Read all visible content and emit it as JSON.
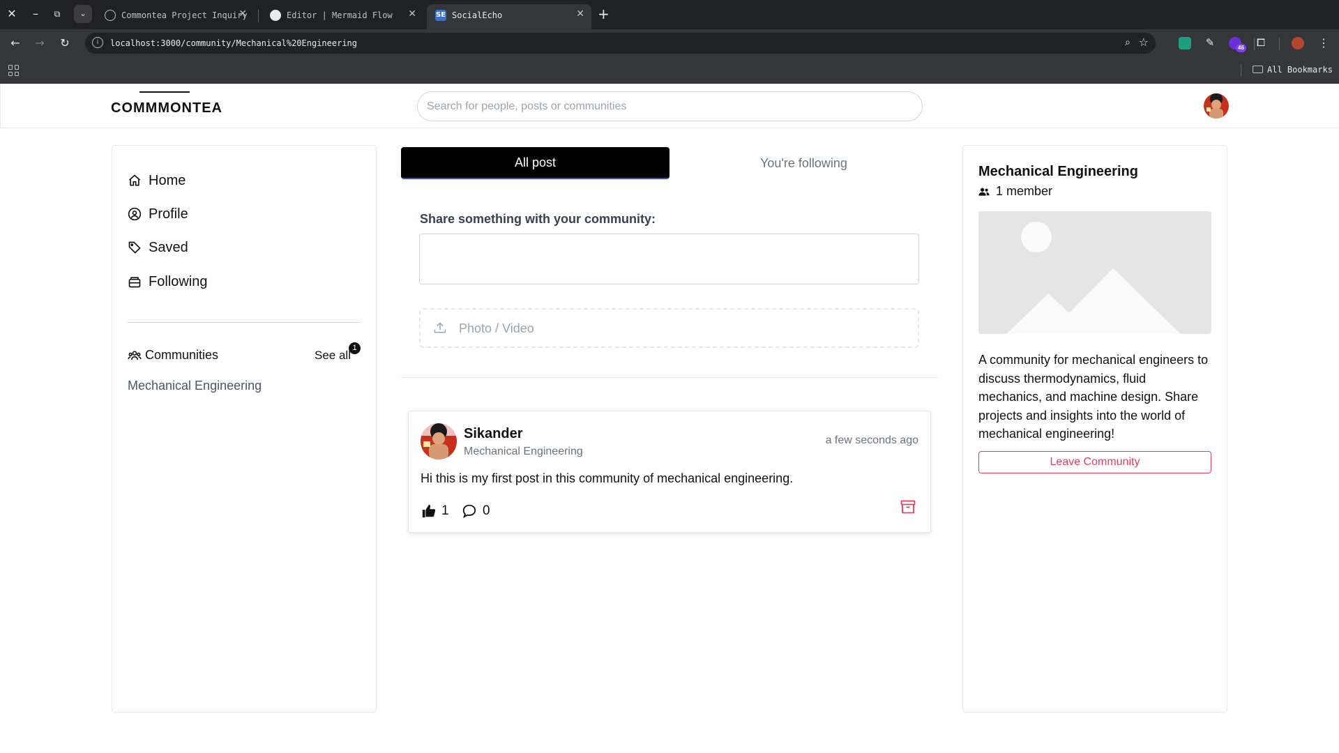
{
  "browser": {
    "tabs": [
      {
        "title": "Commontea Project Inquiry",
        "favicon": "globe-icon",
        "active": false
      },
      {
        "title": "Editor | Mermaid Flow",
        "favicon": "mermaid-icon",
        "active": false
      },
      {
        "title": "SocialEcho",
        "favicon": "socialecho-icon",
        "active": true
      }
    ],
    "url": "localhost:3000/community/Mechanical%20Engineering",
    "extension_badge": "46",
    "bookmarks_label": "All Bookmarks"
  },
  "app": {
    "logo": "COMMMONTEA",
    "search_placeholder": "Search for people, posts or communities"
  },
  "sidebar": {
    "items": [
      {
        "label": "Home",
        "icon": "home-icon"
      },
      {
        "label": "Profile",
        "icon": "user-circle-icon"
      },
      {
        "label": "Saved",
        "icon": "tag-icon"
      },
      {
        "label": "Following",
        "icon": "inbox-icon"
      }
    ],
    "communities_label": "Communities",
    "see_all_label": "See all",
    "see_all_badge": "1",
    "communities": [
      "Mechanical Engineering"
    ]
  },
  "feed": {
    "tabs": [
      {
        "label": "All post",
        "active": true
      },
      {
        "label": "You're following",
        "active": false
      }
    ],
    "share_label": "Share something with your community:",
    "upload_label": "Photo / Video",
    "posts": [
      {
        "author": "Sikander",
        "community": "Mechanical Engineering",
        "time": "a few seconds ago",
        "text": "Hi this is my first post in this community of mechanical engineering.",
        "likes": "1",
        "comments": "0"
      }
    ]
  },
  "community": {
    "name": "Mechanical Engineering",
    "members": "1 member",
    "description": "A community for mechanical engineers to discuss thermodynamics, fluid mechanics, and machine design. Share projects and insights into the world of mechanical engineering!",
    "leave_label": "Leave Community"
  },
  "colors": {
    "accent_danger": "#e63b5a",
    "active_tab_bg": "#000000",
    "browser_dark": "#202124"
  }
}
